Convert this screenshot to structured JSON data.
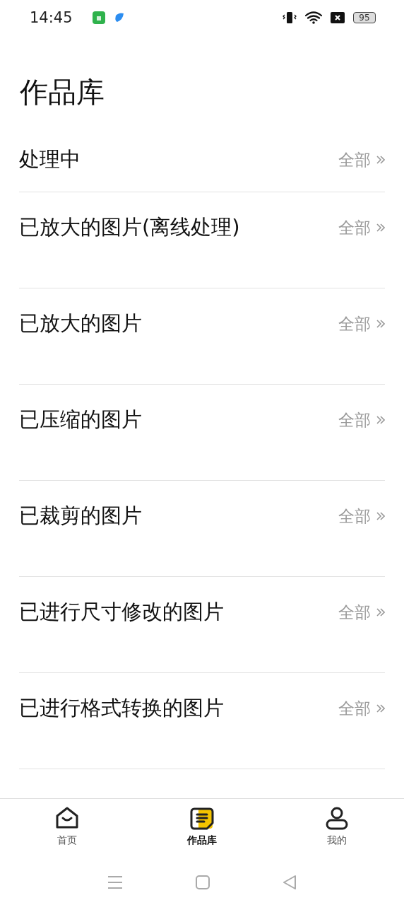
{
  "status_bar": {
    "time": "14:45",
    "battery": "95"
  },
  "title": "作品库",
  "sections": [
    {
      "kind": "compact",
      "title": "处理中",
      "link": "全部"
    },
    {
      "kind": "gallery",
      "title": "已放大的图片(离线处理)",
      "link": "全部"
    },
    {
      "kind": "gallery",
      "title": "已放大的图片",
      "link": "全部"
    },
    {
      "kind": "gallery",
      "title": "已压缩的图片",
      "link": "全部"
    },
    {
      "kind": "gallery",
      "title": "已裁剪的图片",
      "link": "全部"
    },
    {
      "kind": "gallery",
      "title": "已进行尺寸修改的图片",
      "link": "全部"
    },
    {
      "kind": "gallery",
      "title": "已进行格式转换的图片",
      "link": "全部"
    }
  ],
  "tabs": [
    {
      "kind": "home",
      "label": "首页",
      "selected": false
    },
    {
      "kind": "works",
      "label": "作品库",
      "selected": true
    },
    {
      "kind": "profile",
      "label": "我的",
      "selected": false
    }
  ]
}
